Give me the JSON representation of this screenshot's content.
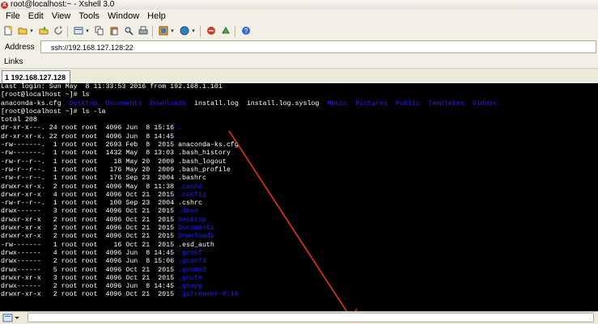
{
  "window": {
    "title": "root@localhost:~ - Xshell 3.0"
  },
  "menu": [
    "File",
    "Edit",
    "View",
    "Tools",
    "Window",
    "Help"
  ],
  "toolbar": {
    "icons": [
      "new-session-icon",
      "open-folder-icon",
      "open-icon",
      "reconnect-icon",
      "properties-icon",
      "copy-icon",
      "paste-icon",
      "find-icon",
      "print-icon",
      "color-scheme-icon",
      "globe-icon",
      "xftp-icon",
      "script-icon",
      "help-icon"
    ]
  },
  "address": {
    "label": "Address",
    "value": "ssh://192.168.127.128:22"
  },
  "links": {
    "label": "Links"
  },
  "tab": {
    "label": "1 192.168.127.128"
  },
  "colors": {
    "dir": "#2020ff",
    "arrow": "#e8321e"
  },
  "terminal": {
    "lines": [
      [
        {
          "t": "Last login: Sun May  8 11:33:53 2016 from 192.168.1.101"
        }
      ],
      [
        {
          "t": "[root@localhost ~]# ls"
        }
      ],
      [
        {
          "t": "anaconda-ks.cfg  "
        },
        {
          "t": "Desktop",
          "c": "dir"
        },
        {
          "t": "  "
        },
        {
          "t": "Documents",
          "c": "dir"
        },
        {
          "t": "  "
        },
        {
          "t": "Downloads",
          "c": "dir"
        },
        {
          "t": "  install.log  install.log.syslog  "
        },
        {
          "t": "Music",
          "c": "dir"
        },
        {
          "t": "  "
        },
        {
          "t": "Pictures",
          "c": "dir"
        },
        {
          "t": "  "
        },
        {
          "t": "Public",
          "c": "dir"
        },
        {
          "t": "  "
        },
        {
          "t": "Templates",
          "c": "dir"
        },
        {
          "t": "  "
        },
        {
          "t": "Videos",
          "c": "dir"
        }
      ],
      [
        {
          "t": "[root@localhost ~]# ls -la"
        }
      ],
      [
        {
          "t": "total 208"
        }
      ],
      [
        {
          "t": "dr-xr-x---. 24 root root  4096 Jun  8 15:16 "
        },
        {
          "t": ".",
          "c": "dir"
        }
      ],
      [
        {
          "t": "dr-xr-xr-x. 22 root root  4096 Jun  8 14:45 "
        },
        {
          "t": "..",
          "c": "dir"
        }
      ],
      [
        {
          "t": "-rw-------.  1 root root  2693 Feb  8  2015 anaconda-ks.cfg"
        }
      ],
      [
        {
          "t": "-rw-------.  1 root root  1432 May  8 13:03 .bash_history"
        }
      ],
      [
        {
          "t": "-rw-r--r--.  1 root root    18 May 20  2009 .bash_logout"
        }
      ],
      [
        {
          "t": "-rw-r--r--.  1 root root   176 May 20  2009 .bash_profile"
        }
      ],
      [
        {
          "t": "-rw-r--r--.  1 root root   176 Sep 23  2004 .bashrc"
        }
      ],
      [
        {
          "t": "drwxr-xr-x.  2 root root  4096 May  8 11:38 "
        },
        {
          "t": ".cache",
          "c": "dir"
        }
      ],
      [
        {
          "t": "drwxr-xr-x   4 root root  4096 Oct 21  2015 "
        },
        {
          "t": ".config",
          "c": "dir"
        }
      ],
      [
        {
          "t": "-rw-r--r--.  1 root root   100 Sep 23  2004 .cshrc"
        }
      ],
      [
        {
          "t": "drwx------   3 root root  4096 Oct 21  2015 "
        },
        {
          "t": ".dbus",
          "c": "dir"
        }
      ],
      [
        {
          "t": "drwxr-xr-x   2 root root  4096 Oct 21  2015 "
        },
        {
          "t": "Desktop",
          "c": "dir"
        }
      ],
      [
        {
          "t": "drwxr-xr-x   2 root root  4096 Oct 21  2015 "
        },
        {
          "t": "Documents",
          "c": "dir"
        }
      ],
      [
        {
          "t": "drwxr-xr-x   2 root root  4096 Oct 21  2015 "
        },
        {
          "t": "Downloads",
          "c": "dir"
        }
      ],
      [
        {
          "t": "-rw-------   1 root root    16 Oct 21  2015 .esd_auth"
        }
      ],
      [
        {
          "t": "drwx------   4 root root  4096 Jun  8 14:45 "
        },
        {
          "t": ".gconf",
          "c": "dir"
        }
      ],
      [
        {
          "t": "drwx------   2 root root  4096 Jun  8 15:06 "
        },
        {
          "t": ".gconfd",
          "c": "dir"
        }
      ],
      [
        {
          "t": "drwx------   5 root root  4096 Oct 21  2015 "
        },
        {
          "t": ".gnome2",
          "c": "dir"
        }
      ],
      [
        {
          "t": "drwxr-xr-x   3 root root  4096 Oct 21  2015 "
        },
        {
          "t": ".gnote",
          "c": "dir"
        }
      ],
      [
        {
          "t": "drwx------   2 root root  4096 Jun  8 14:45 "
        },
        {
          "t": ".gnupg",
          "c": "dir"
        }
      ],
      [
        {
          "t": "drwxr-xr-x   2 root root  4096 Oct 21  2015 "
        },
        {
          "t": ".gstreamer-0.10",
          "c": "dir"
        }
      ]
    ]
  }
}
